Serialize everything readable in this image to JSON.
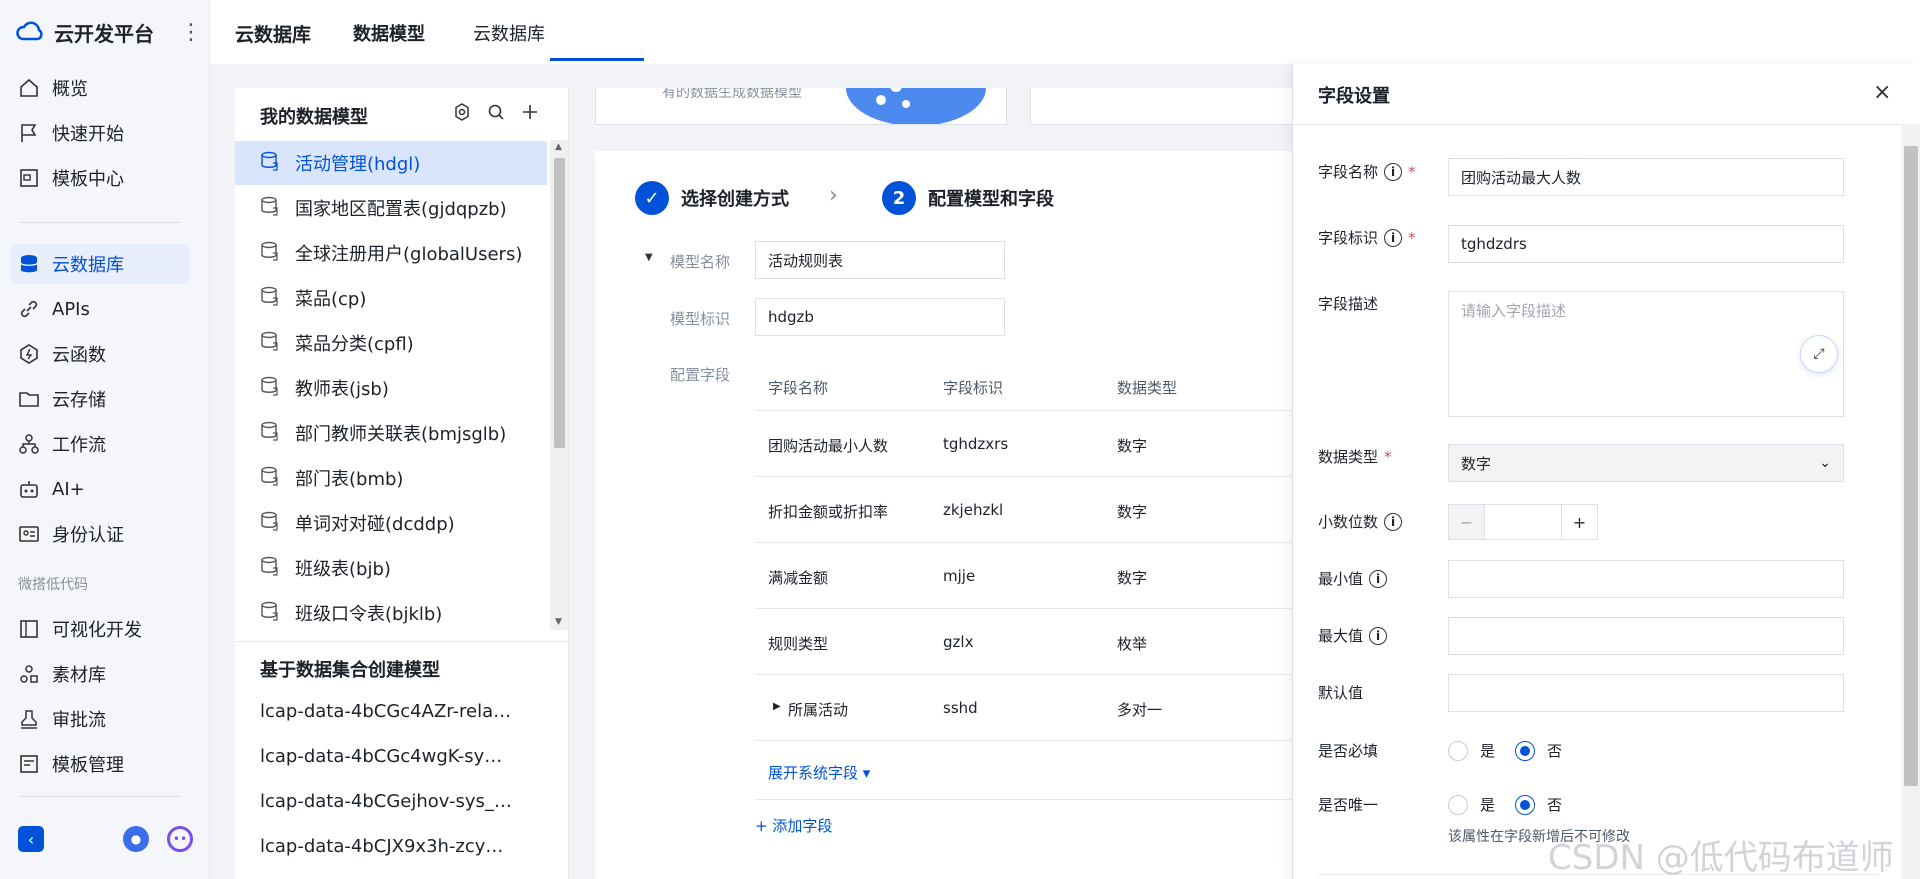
{
  "brand": {
    "name": "云开发平台"
  },
  "nav": {
    "items": [
      {
        "label": "概览"
      },
      {
        "label": "快速开始"
      },
      {
        "label": "模板中心"
      },
      {
        "label": "云数据库"
      },
      {
        "label": "APIs"
      },
      {
        "label": "云函数"
      },
      {
        "label": "云存储"
      },
      {
        "label": "工作流"
      },
      {
        "label": "AI+"
      },
      {
        "label": "身份认证"
      },
      {
        "label": "可视化开发"
      },
      {
        "label": "素材库"
      },
      {
        "label": "审批流"
      },
      {
        "label": "模板管理"
      }
    ],
    "group_label": "微搭低代码"
  },
  "topbar": {
    "title": "云数据库",
    "tab_active": "数据模型",
    "tab_other": "云数据库"
  },
  "model_list": {
    "heading": "我的数据模型",
    "items": [
      {
        "label": "活动管理(hdgl)"
      },
      {
        "label": "国家地区配置表(gjdqpzb)"
      },
      {
        "label": "全球注册用户(globalUsers)"
      },
      {
        "label": "菜品(cp)"
      },
      {
        "label": "菜品分类(cpfl)"
      },
      {
        "label": "教师表(jsb)"
      },
      {
        "label": "部门教师关联表(bmjsglb)"
      },
      {
        "label": "部门表(bmb)"
      },
      {
        "label": "单词对对碰(dcddp)"
      },
      {
        "label": "班级表(bjb)"
      },
      {
        "label": "班级口令表(bjklb)"
      }
    ],
    "dataset_heading": "基于数据集合创建模型",
    "datasets": [
      {
        "label": "lcap-data-4bCGc4AZr-rela…"
      },
      {
        "label": "lcap-data-4bCGc4wgK-sy…"
      },
      {
        "label": "lcap-data-4bCGejhov-sys_…"
      },
      {
        "label": "lcap-data-4bCJX9x3h-zcy…"
      }
    ]
  },
  "center": {
    "banner_text": "有的数据生成数据模型",
    "step1": "选择创建方式",
    "step2_num": "2",
    "step2": "配置模型和字段",
    "model_name_label": "模型名称",
    "model_name_value": "活动规则表",
    "model_id_label": "模型标识",
    "model_id_value": "hdgzb",
    "fields_label": "配置字段",
    "table_headers": [
      "字段名称",
      "字段标识",
      "数据类型"
    ],
    "rows": [
      {
        "name": "团购活动最小人数",
        "id": "tghdzxrs",
        "type": "数字"
      },
      {
        "name": "折扣金额或折扣率",
        "id": "zkjehzkl",
        "type": "数字"
      },
      {
        "name": "满减金额",
        "id": "mjje",
        "type": "数字"
      },
      {
        "name": "规则类型",
        "id": "gzlx",
        "type": "枚举"
      },
      {
        "name": "所属活动",
        "id": "sshd",
        "type": "多对一"
      }
    ],
    "expand_link": "展开系统字段 ▾",
    "add_field": "+ 添加字段"
  },
  "drawer": {
    "title": "字段设置",
    "field_name_label": "字段名称",
    "field_name_value": "团购活动最大人数",
    "field_id_label": "字段标识",
    "field_id_value": "tghdzdrs",
    "desc_label": "字段描述",
    "desc_placeholder": "请输入字段描述",
    "type_label": "数据类型",
    "type_value": "数字",
    "decimal_label": "小数位数",
    "min_label": "最小值",
    "max_label": "最大值",
    "default_label": "默认值",
    "required_label": "是否必填",
    "unique_label": "是否唯一",
    "yes": "是",
    "no": "否",
    "unique_hint": "该属性在字段新增后不可修改"
  },
  "watermark": "CSDN @低代码布道师",
  "colors": {
    "accent": "#0052d9",
    "active_bg": "#d9e5fd"
  }
}
